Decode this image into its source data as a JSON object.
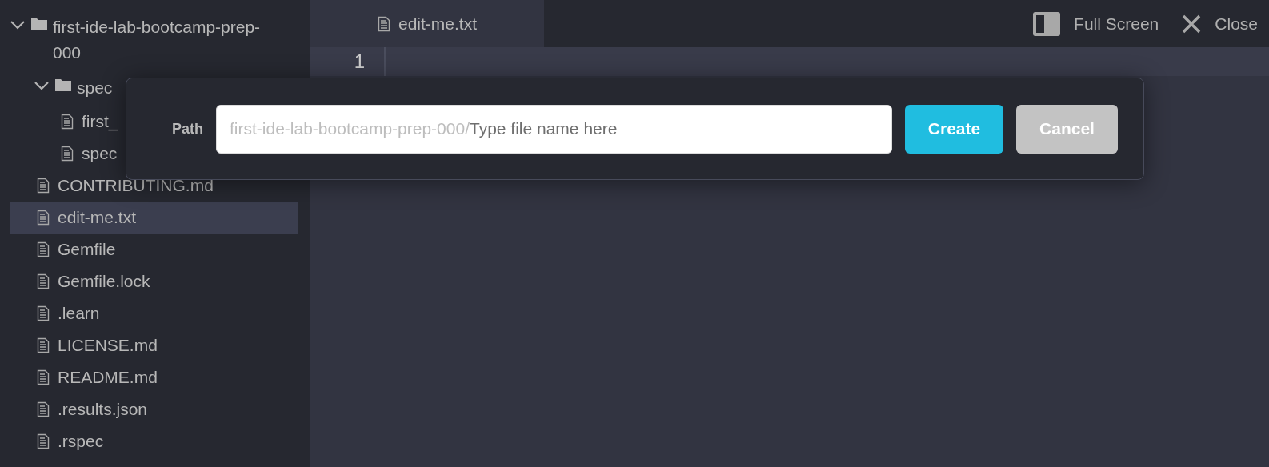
{
  "tree": [
    {
      "kind": "folder",
      "name": "first-ide-lab-bootcamp-prep-000",
      "expanded": true,
      "children": [
        {
          "kind": "folder",
          "name": "spec",
          "expanded": true,
          "children": [
            {
              "kind": "file",
              "name": "first_",
              "selected": false
            },
            {
              "kind": "file",
              "name": "spec",
              "selected": false
            }
          ]
        },
        {
          "kind": "file",
          "name": "CONTRIBUTING.md",
          "selected": false
        },
        {
          "kind": "file",
          "name": "edit-me.txt",
          "selected": true
        },
        {
          "kind": "file",
          "name": "Gemfile",
          "selected": false
        },
        {
          "kind": "file",
          "name": "Gemfile.lock",
          "selected": false
        },
        {
          "kind": "file",
          "name": ".learn",
          "selected": false
        },
        {
          "kind": "file",
          "name": "LICENSE.md",
          "selected": false
        },
        {
          "kind": "file",
          "name": "README.md",
          "selected": false
        },
        {
          "kind": "file",
          "name": ".results.json",
          "selected": false
        },
        {
          "kind": "file",
          "name": ".rspec",
          "selected": false
        }
      ]
    }
  ],
  "tabs": [
    {
      "label": "edit-me.txt",
      "selected": true
    }
  ],
  "toolbar": [
    {
      "kind": "fullscreen",
      "label": "Full Screen"
    },
    {
      "kind": "close",
      "label": "Close"
    }
  ],
  "editor": {
    "line_numbers": [
      "1"
    ]
  },
  "dialog": {
    "label": "Path",
    "prefix": "first-ide-lab-bootcamp-prep-000/",
    "placeholder": "Type file name here",
    "buttons": [
      {
        "kind": "primary",
        "label": "Create"
      },
      {
        "kind": "secondary",
        "label": "Cancel"
      }
    ]
  }
}
